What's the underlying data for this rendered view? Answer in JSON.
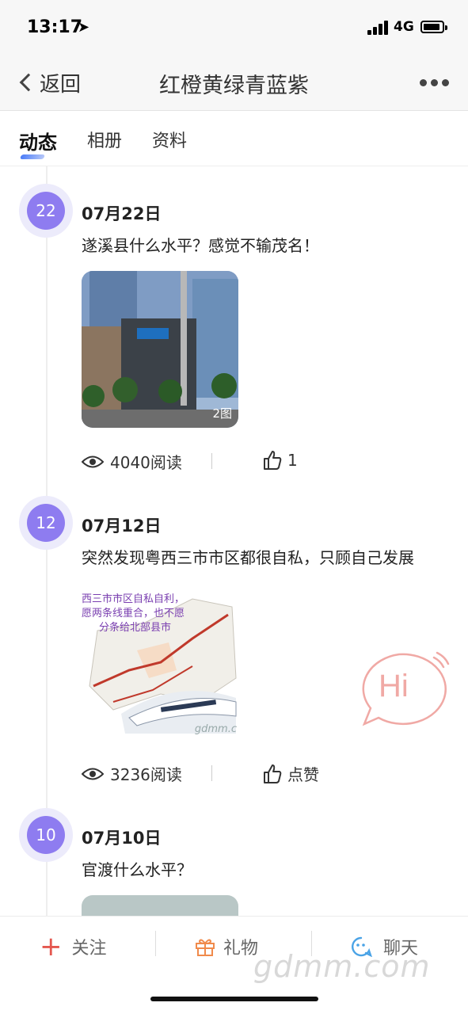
{
  "status_bar": {
    "time": "13:17",
    "network": "4G"
  },
  "nav": {
    "back_label": "返回",
    "title": "红橙黄绿青蓝紫"
  },
  "tabs": [
    {
      "label": "动态"
    },
    {
      "label": "相册"
    },
    {
      "label": "资料"
    }
  ],
  "posts": [
    {
      "day": "22",
      "date": "07月22日",
      "text": "遂溪县什么水平？感觉不输茂名！",
      "photo_count": "2图",
      "reads": "4040阅读",
      "likes": "1"
    },
    {
      "day": "12",
      "date": "07月12日",
      "text": "突然发现粤西三市市区都很自私，只顾自己发展",
      "map_caption_1": "西三市市区自私自利，",
      "map_caption_2": "愿两条线重合，也不愿",
      "map_caption_3": "分条给北部县市",
      "map_watermark": "gdmm.c",
      "reads": "3236阅读",
      "likes": "点赞"
    },
    {
      "day": "10",
      "date": "07月10日",
      "text": "官渡什么水平？"
    }
  ],
  "hi_bubble": {
    "label": "Hi"
  },
  "bottom_bar": {
    "follow": "关注",
    "gift": "礼物",
    "chat": "聊天"
  },
  "watermark": "gdmm.com",
  "colors": {
    "badge": "#8e7cf0",
    "follow": "#e4574f",
    "gift": "#f08a4b",
    "chat": "#4aa3e6",
    "hi": "#f0a9a5"
  }
}
